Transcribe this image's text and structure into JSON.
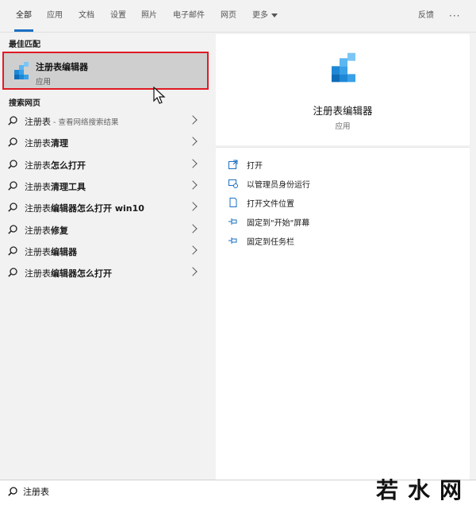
{
  "tabs": [
    {
      "label": "全部",
      "active": true
    },
    {
      "label": "应用"
    },
    {
      "label": "文档"
    },
    {
      "label": "设置"
    },
    {
      "label": "照片"
    },
    {
      "label": "电子邮件"
    },
    {
      "label": "网页"
    },
    {
      "label": "更多"
    }
  ],
  "header_right": {
    "feedback": "反馈",
    "more": "···"
  },
  "left": {
    "best_match_label": "最佳匹配",
    "best_match": {
      "title": "注册表编辑器",
      "subtitle": "应用",
      "icon": "registry-editor-icon"
    },
    "web_label": "搜索网页",
    "web_results": [
      {
        "query": "注册表",
        "suffix": "",
        "hint": " - 查看网络搜索结果"
      },
      {
        "query": "注册表",
        "suffix": "清理",
        "hint": ""
      },
      {
        "query": "注册表",
        "suffix": "怎么打开",
        "hint": ""
      },
      {
        "query": "注册表",
        "suffix": "清理工具",
        "hint": ""
      },
      {
        "query": "注册表",
        "suffix": "编辑器怎么打开 win10",
        "hint": ""
      },
      {
        "query": "注册表",
        "suffix": "修复",
        "hint": ""
      },
      {
        "query": "注册表",
        "suffix": "编辑器",
        "hint": ""
      },
      {
        "query": "注册表",
        "suffix": "编辑器怎么打开",
        "hint": ""
      }
    ]
  },
  "right": {
    "app_title": "注册表编辑器",
    "app_subtitle": "应用",
    "actions": [
      {
        "label": "打开",
        "icon": "open-icon"
      },
      {
        "label": "以管理员身份运行",
        "icon": "run-as-admin-icon"
      },
      {
        "label": "打开文件位置",
        "icon": "file-location-icon"
      },
      {
        "label": "固定到\"开始\"屏幕",
        "icon": "pin-icon"
      },
      {
        "label": "固定到任务栏",
        "icon": "pin-icon"
      }
    ]
  },
  "search": {
    "value": "注册表"
  },
  "watermark": "若水网",
  "colors": {
    "accent": "#1a6fc2",
    "highlight_border": "#e01b24",
    "icon_blue": "#1e88d6"
  }
}
